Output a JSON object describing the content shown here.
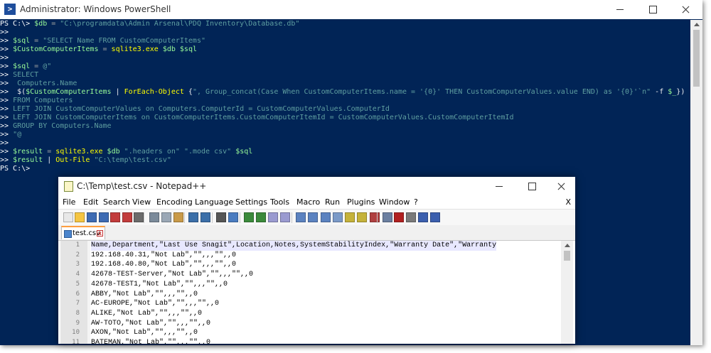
{
  "powershell": {
    "title": "Administrator: Windows PowerShell",
    "lines": [
      [
        [
          "t-prompt",
          "PS C:\\> "
        ],
        [
          "t-var",
          "$db"
        ],
        [
          "t-op",
          " = "
        ],
        [
          "t-str",
          "\"C:\\programdata\\Admin Arsenal\\PDQ Inventory\\Database.db\""
        ]
      ],
      [
        [
          "t-prompt",
          ">>"
        ]
      ],
      [
        [
          "t-prompt",
          ">> "
        ],
        [
          "t-var",
          "$sql"
        ],
        [
          "t-op",
          " = "
        ],
        [
          "t-str",
          "\"SELECT Name FROM CustomComputerItems\""
        ]
      ],
      [
        [
          "t-prompt",
          ">> "
        ],
        [
          "t-var",
          "$CustomComputerItems"
        ],
        [
          "t-op",
          " = "
        ],
        [
          "t-cmd",
          "sqlite3.exe"
        ],
        [
          "t-plain",
          " "
        ],
        [
          "t-var",
          "$db"
        ],
        [
          "t-plain",
          " "
        ],
        [
          "t-var",
          "$sql"
        ]
      ],
      [
        [
          "t-prompt",
          ">>"
        ]
      ],
      [
        [
          "t-prompt",
          ">> "
        ],
        [
          "t-var",
          "$sql"
        ],
        [
          "t-op",
          " = "
        ],
        [
          "t-str",
          "@\""
        ]
      ],
      [
        [
          "t-prompt",
          ">> "
        ],
        [
          "t-str",
          "SELECT"
        ]
      ],
      [
        [
          "t-prompt",
          ">> "
        ],
        [
          "t-str",
          " Computers.Name"
        ]
      ],
      [
        [
          "t-prompt",
          ">> "
        ],
        [
          "t-plain",
          " $("
        ],
        [
          "t-var",
          "$CustomComputerItems"
        ],
        [
          "t-plain",
          " | "
        ],
        [
          "t-cmd",
          "ForEach-Object"
        ],
        [
          "t-plain",
          " {"
        ],
        [
          "t-str",
          "\", Group_concat(Case When CustomComputerItems.name = '{0}' THEN CustomComputerValues.value END) as '{0}'`n\""
        ],
        [
          "t-plain",
          " -f "
        ],
        [
          "t-var",
          "$_"
        ],
        [
          "t-plain",
          "})"
        ]
      ],
      [
        [
          "t-prompt",
          ">> "
        ],
        [
          "t-str",
          "FROM Computers"
        ]
      ],
      [
        [
          "t-prompt",
          ">> "
        ],
        [
          "t-str",
          "LEFT JOIN CustomComputerValues on Computers.ComputerId = CustomComputerValues.ComputerId"
        ]
      ],
      [
        [
          "t-prompt",
          ">> "
        ],
        [
          "t-str",
          "LEFT JOIN CustomComputerItems on CustomComputerItems.CustomComputerItemId = CustomComputerValues.CustomComputerItemId"
        ]
      ],
      [
        [
          "t-prompt",
          ">> "
        ],
        [
          "t-str",
          "GROUP BY Computers.Name"
        ]
      ],
      [
        [
          "t-prompt",
          ">> "
        ],
        [
          "t-str",
          "\"@"
        ]
      ],
      [
        [
          "t-prompt",
          ">>"
        ]
      ],
      [
        [
          "t-prompt",
          ">> "
        ],
        [
          "t-var",
          "$result"
        ],
        [
          "t-op",
          " = "
        ],
        [
          "t-cmd",
          "sqlite3.exe"
        ],
        [
          "t-plain",
          " "
        ],
        [
          "t-var",
          "$db"
        ],
        [
          "t-plain",
          " "
        ],
        [
          "t-str",
          "\".headers on\""
        ],
        [
          "t-plain",
          " "
        ],
        [
          "t-str",
          "\".mode csv\""
        ],
        [
          "t-plain",
          " "
        ],
        [
          "t-var",
          "$sql"
        ]
      ],
      [
        [
          "t-prompt",
          ">> "
        ],
        [
          "t-var",
          "$result"
        ],
        [
          "t-plain",
          " | "
        ],
        [
          "t-cmd",
          "Out-File"
        ],
        [
          "t-plain",
          " "
        ],
        [
          "t-str",
          "\"C:\\temp\\test.csv\""
        ]
      ],
      [
        [
          "t-prompt",
          "PS C:\\>"
        ]
      ]
    ]
  },
  "notepad": {
    "title": "C:\\Temp\\test.csv - Notepad++",
    "menu": [
      "File",
      "Edit",
      "Search",
      "View",
      "Encoding",
      "Language",
      "Settings",
      "Tools",
      "Macro",
      "Run",
      "Plugins",
      "Window",
      "?"
    ],
    "menu_close": "X",
    "tab_label": "test.csv",
    "tab_close": "x",
    "lines": [
      "Name,Department,\"Last Use Snagit\",Location,Notes,SystemStabilityIndex,\"Warranty Date\",\"Warranty",
      "192.168.40.31,\"Not Lab\",\"\",,,\"\",,0",
      "192.168.40.80,\"Not Lab\",\"\",,,\"\",,0",
      "42678-TEST-Server,\"Not Lab\",\"\",,,\"\",,0",
      "42678-TEST1,\"Not Lab\",\"\",,,\"\",,0",
      "ABBY,\"Not Lab\",\"\",,,\"\",,0",
      "AC-EUROPE,\"Not Lab\",\"\",,,\"\",,0",
      "ALIKE,\"Not Lab\",\"\",,,\"\",,0",
      "AW-TOTO,\"Not Lab\",\"\",,,\"\",,0",
      "AXON,\"Not Lab\",\"\",,,\"\",,0",
      "BATEMAN,\"Not Lab\",\"\",,,\"\",,0"
    ]
  },
  "colors": {
    "ps_background": "#012456",
    "ps_prompt": "#ffffff",
    "ps_variable": "#98fb98",
    "ps_string": "#5f9ea0",
    "ps_command": "#ffff00",
    "npp_current_line": "#e8e8ff",
    "npp_tab_accent": "#ff9e3f"
  },
  "icons": {
    "ps_app": "powershell-icon",
    "npp_app": "notepadpp-icon",
    "toolbar": [
      "new-file-icon",
      "open-file-icon",
      "save-icon",
      "save-all-icon",
      "close-icon",
      "close-all-icon",
      "print-icon",
      "cut-icon",
      "copy-icon",
      "paste-icon",
      "undo-icon",
      "redo-icon",
      "find-icon",
      "replace-icon",
      "zoom-in-icon",
      "zoom-out-icon",
      "sync-v-icon",
      "sync-h-icon",
      "word-wrap-icon",
      "show-all-chars-icon",
      "indent-guide-icon",
      "doc-map-icon",
      "function-list-icon",
      "folder-workspace-icon",
      "monitor-icon",
      "record-macro-icon",
      "stop-macro-icon",
      "play-macro-icon",
      "run-macro-multiple-icon",
      "save-macro-icon"
    ]
  }
}
